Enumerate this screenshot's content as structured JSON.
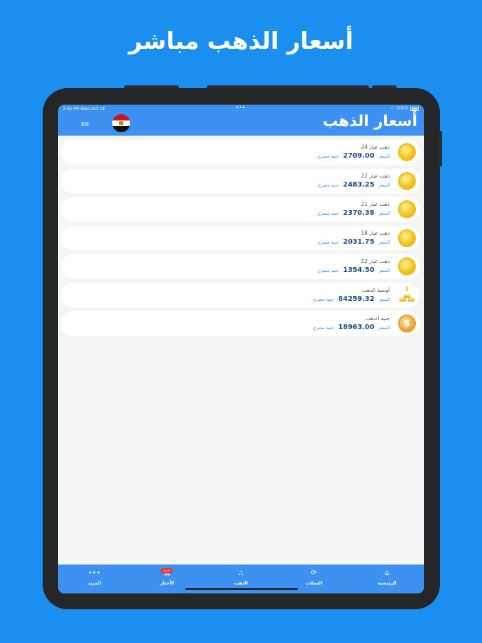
{
  "promo": {
    "title": "أسعار الذهب مباشر"
  },
  "status_bar": {
    "time": "2:26 PM  Wed Oct 18",
    "battery": "100%"
  },
  "header": {
    "title": "أسعار الذهب",
    "lang_button": "EN",
    "flag": "egypt-flag"
  },
  "items": [
    {
      "name": "ذهب عيار 24",
      "price_label": "السعر",
      "price": "2709.00",
      "currency": "جنيه مصري",
      "icon": "gold-coin-icon"
    },
    {
      "name": "ذهب عيار 22",
      "price_label": "السعر",
      "price": "2483.25",
      "currency": "جنيه مصري",
      "icon": "gold-coin-icon"
    },
    {
      "name": "ذهب عيار 21",
      "price_label": "السعر",
      "price": "2370.38",
      "currency": "جنيه مصري",
      "icon": "gold-coin-icon"
    },
    {
      "name": "ذهب عيار 18",
      "price_label": "السعر",
      "price": "2031.75",
      "currency": "جنيه مصري",
      "icon": "gold-coin-icon"
    },
    {
      "name": "ذهب عيار 12",
      "price_label": "السعر",
      "price": "1354.50",
      "currency": "جنيه مصري",
      "icon": "gold-coin-icon"
    },
    {
      "name": "أونصة الذهب",
      "price_label": "السعر",
      "price": "84259.32",
      "currency": "جنيه مصري",
      "icon": "gold-bars-icon"
    },
    {
      "name": "جنيه الذهب",
      "price_label": "السعر",
      "price": "18963.00",
      "currency": "جنيه مصري",
      "icon": "gold-pound-icon"
    }
  ],
  "tabbar": {
    "more": {
      "label": "المزيد",
      "icon": "more-dots-icon"
    },
    "news": {
      "label": "الأخبار",
      "icon": "news-icon",
      "badge": "جديد"
    },
    "gold": {
      "label": "الذهب",
      "icon": "gold-icon"
    },
    "currencies": {
      "label": "العملات",
      "icon": "currency-exchange-icon"
    },
    "home": {
      "label": "الرئيسية",
      "icon": "home-icon"
    }
  },
  "colors": {
    "background": "#1a8fef",
    "header": "#3d91f1",
    "price": "#1e4f86",
    "accent": "#3d91f1"
  }
}
